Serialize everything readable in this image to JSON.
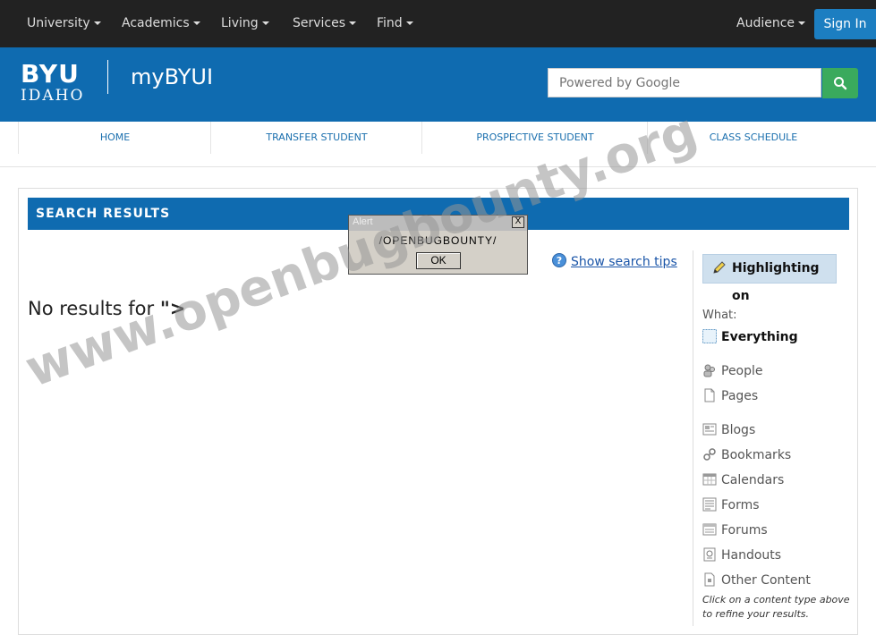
{
  "topnav": {
    "items": [
      "University",
      "Academics",
      "Living",
      "Services",
      "Find"
    ],
    "audience": "Audience",
    "signin": "Sign In"
  },
  "header": {
    "logo_top": "BYU",
    "logo_bottom": "IDAHO",
    "site_title": "myBYUI",
    "search_placeholder": "Powered by Google"
  },
  "subnav": {
    "items": [
      "HOME",
      "TRANSFER STUDENT",
      "PROSPECTIVE STUDENT",
      "CLASS SCHEDULE"
    ]
  },
  "results": {
    "bar_title": "SEARCH RESULTS",
    "no_results_prefix": "No results for ",
    "query": "\">",
    "tips_link": "Show search tips"
  },
  "sidebar": {
    "highlight_label": "Highlighting on",
    "what_label": "What:",
    "filters": [
      "Everything",
      "People",
      "Pages",
      "Blogs",
      "Bookmarks",
      "Calendars",
      "Forms",
      "Forums",
      "Handouts",
      "Other Content"
    ],
    "refine_note": "Click on a content type above to refine your results."
  },
  "alert": {
    "title": "Alert",
    "close": "X",
    "message": "/OPENBUGBOUNTY/",
    "ok": "OK"
  },
  "watermark": "www.openbugbounty.org",
  "colors": {
    "topbar": "#222222",
    "brand_blue": "#0f6bb0",
    "search_green": "#3aaa5d",
    "signin_blue": "#1c7ec1"
  }
}
